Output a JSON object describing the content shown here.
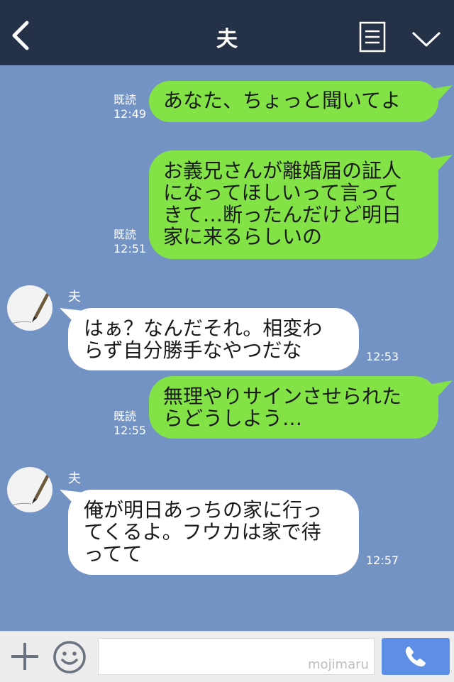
{
  "header": {
    "title": "夫"
  },
  "messages": [
    {
      "side": "out",
      "read": "既読",
      "time": "12:49",
      "lines": [
        "あなた、ちょっと聞いてよ"
      ]
    },
    {
      "side": "out",
      "read": "既読",
      "time": "12:51",
      "lines": [
        "お義兄さんが離婚届の証人",
        "になってほしいって言って",
        "きて…断ったんだけど明日",
        "家に来るらしいの"
      ]
    },
    {
      "side": "in",
      "sender": "夫",
      "time": "12:53",
      "lines": [
        "はぁ？なんだそれ。相変わ",
        "らず自分勝手なやつだな"
      ]
    },
    {
      "side": "out",
      "read": "既読",
      "time": "12:55",
      "lines": [
        "無理やりサインさせられた",
        "らどうしよう…"
      ]
    },
    {
      "side": "in",
      "sender": "夫",
      "time": "12:57",
      "lines": [
        "俺が明日あっちの家に行っ",
        "てくるよ。フウカは家で待",
        "ってて"
      ]
    }
  ],
  "input": {
    "placeholder": ""
  },
  "watermark": "mojimaru",
  "colors": {
    "header_bg": "#253147",
    "chat_bg": "#7493c5",
    "outgoing_bubble": "#82e246",
    "incoming_bubble": "#ffffff",
    "call_button": "#5d8fe6"
  },
  "icons": [
    "back-arrow-icon",
    "menu-list-icon",
    "chevron-down-icon",
    "plus-icon",
    "smiley-icon",
    "phone-icon",
    "pen-avatar-icon"
  ]
}
